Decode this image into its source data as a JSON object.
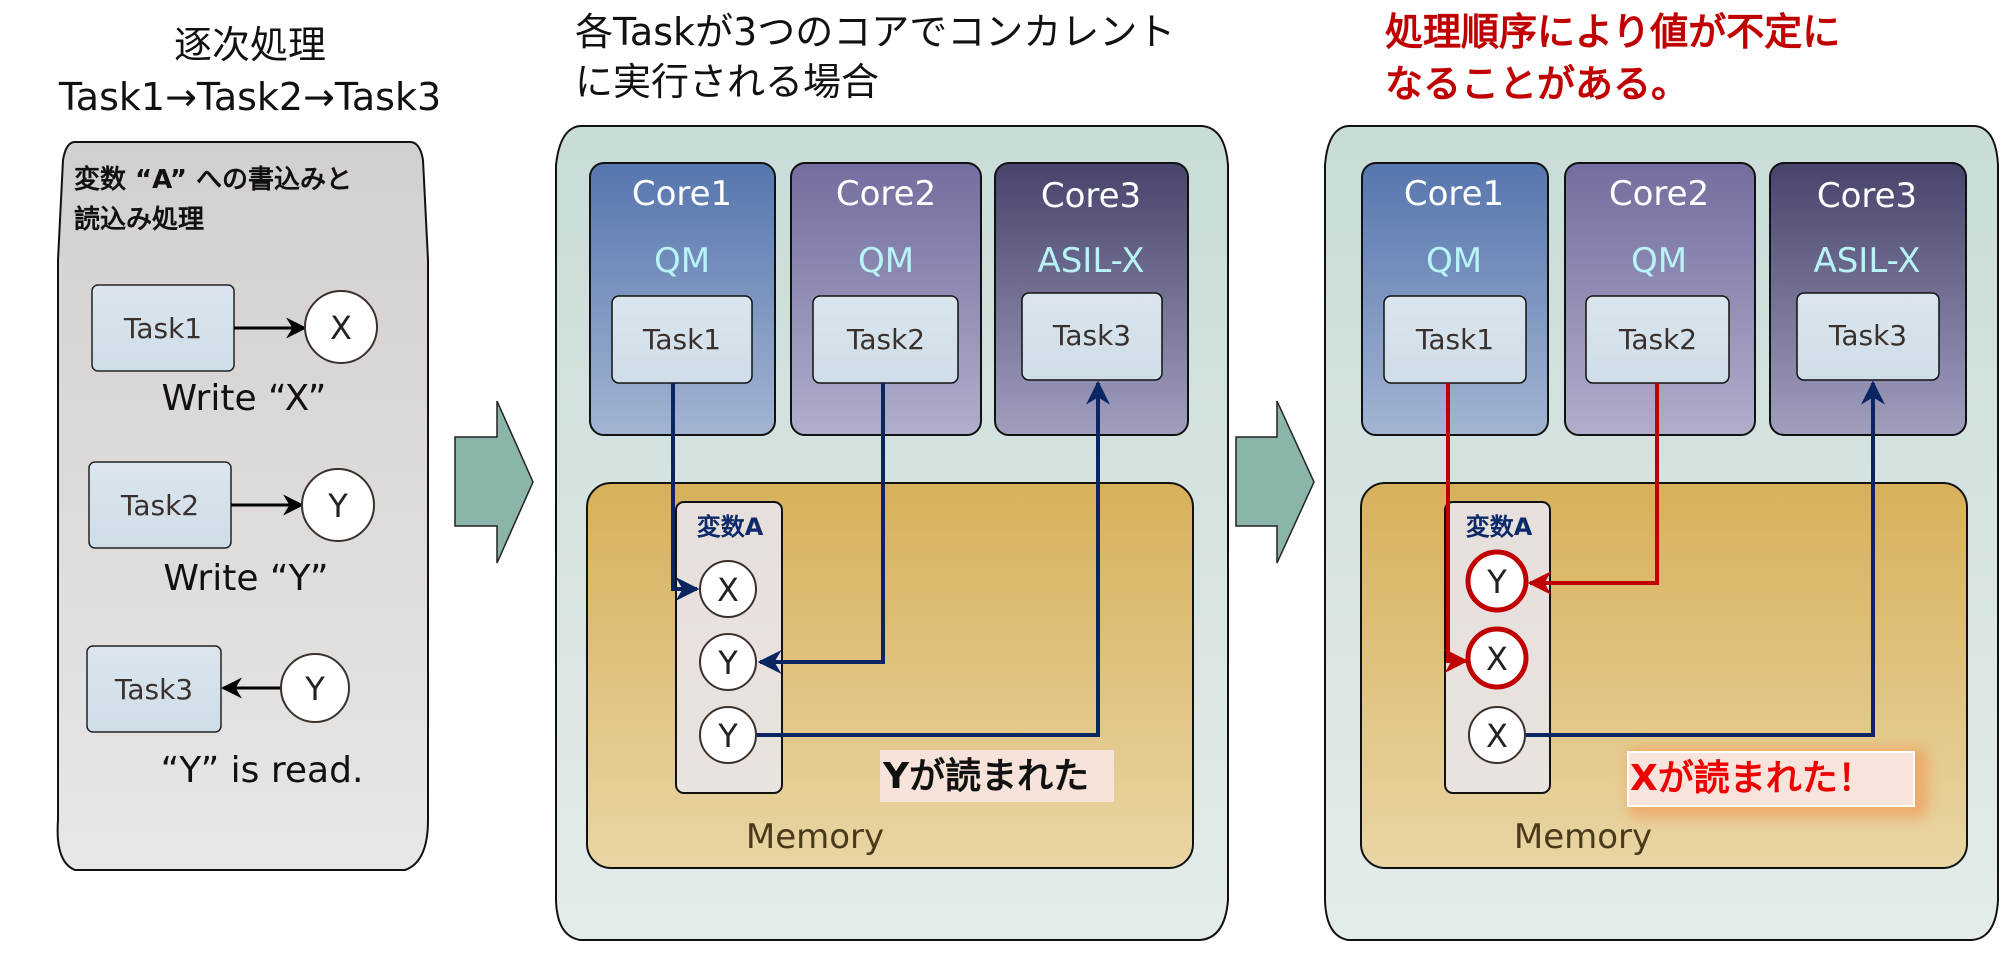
{
  "colors": {
    "wire_blue": "#0b2563",
    "wire_red": "#c00000",
    "memory_top": "#d8b15c",
    "memory_bottom": "#e8d4a2",
    "panel_bg": "#cfe0dc",
    "left_panel_bg": "#d8d5d4",
    "core1": "#5f7fb4",
    "core2": "#7d79a8",
    "core3": "#514f75",
    "arrow_fill": "#8bb4ab",
    "alert_text": "#ee0000",
    "title_red": "#c00000"
  },
  "left": {
    "title_line1": "逐次処理",
    "title_line2": "Task1→Task2→Task3",
    "panel_heading_line1": "変数 “A” への書込みと",
    "panel_heading_line2": "読込み処理",
    "steps": [
      {
        "task": "Task1",
        "value": "X",
        "direction": "write",
        "caption": "Write “X”"
      },
      {
        "task": "Task2",
        "value": "Y",
        "direction": "write",
        "caption": "Write “Y”"
      },
      {
        "task": "Task3",
        "value": "Y",
        "direction": "read",
        "caption": "“Y” is read."
      }
    ]
  },
  "middle": {
    "title_line1": "各Taskが3つのコアでコンカレント",
    "title_line2": "に実行される場合",
    "cores": [
      {
        "name": "Core1",
        "level": "QM",
        "task": "Task1"
      },
      {
        "name": "Core2",
        "level": "QM",
        "task": "Task2"
      },
      {
        "name": "Core3",
        "level": "ASIL-X",
        "task": "Task3"
      }
    ],
    "variable_label": "変数A",
    "cells": [
      "X",
      "Y",
      "Y"
    ],
    "memory_label": "Memory",
    "result_label": "Yが読まれた"
  },
  "right": {
    "title_line1": "処理順序により値が不定に",
    "title_line2": "なることがある。",
    "cores": [
      {
        "name": "Core1",
        "level": "QM",
        "task": "Task1"
      },
      {
        "name": "Core2",
        "level": "QM",
        "task": "Task2"
      },
      {
        "name": "Core3",
        "level": "ASIL-X",
        "task": "Task3"
      }
    ],
    "variable_label": "変数A",
    "cells": [
      "Y",
      "X",
      "X"
    ],
    "memory_label": "Memory",
    "result_label": "Xが読まれた！"
  }
}
